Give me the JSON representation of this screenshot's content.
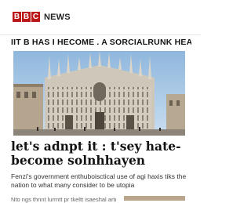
{
  "header": {
    "logo_letters": [
      "B",
      "B",
      "C"
    ],
    "logo_word": "NEWS"
  },
  "article": {
    "kicker": "IIT B HAS I HECOME . A SORCIALRUNK HEAVEN",
    "headline_line1": "let's adnpt it : t'sey hate-",
    "headline_line2": "become solnhhayen",
    "standfirst": "Fenzi's government enthuboisctical use of agi haxis tiks the nation to what many consider to be utopia",
    "body_snippet": "Nto ngs thnnt lurmtt pr tkeltt isaeshal arte tht"
  },
  "colors": {
    "brand_red": "#bb1919",
    "headline": "#111111",
    "sky": "#a9c9e6",
    "cathedral_stone": "#cfc8ba"
  },
  "icons": {
    "hero_image": "cathedral-photo"
  }
}
